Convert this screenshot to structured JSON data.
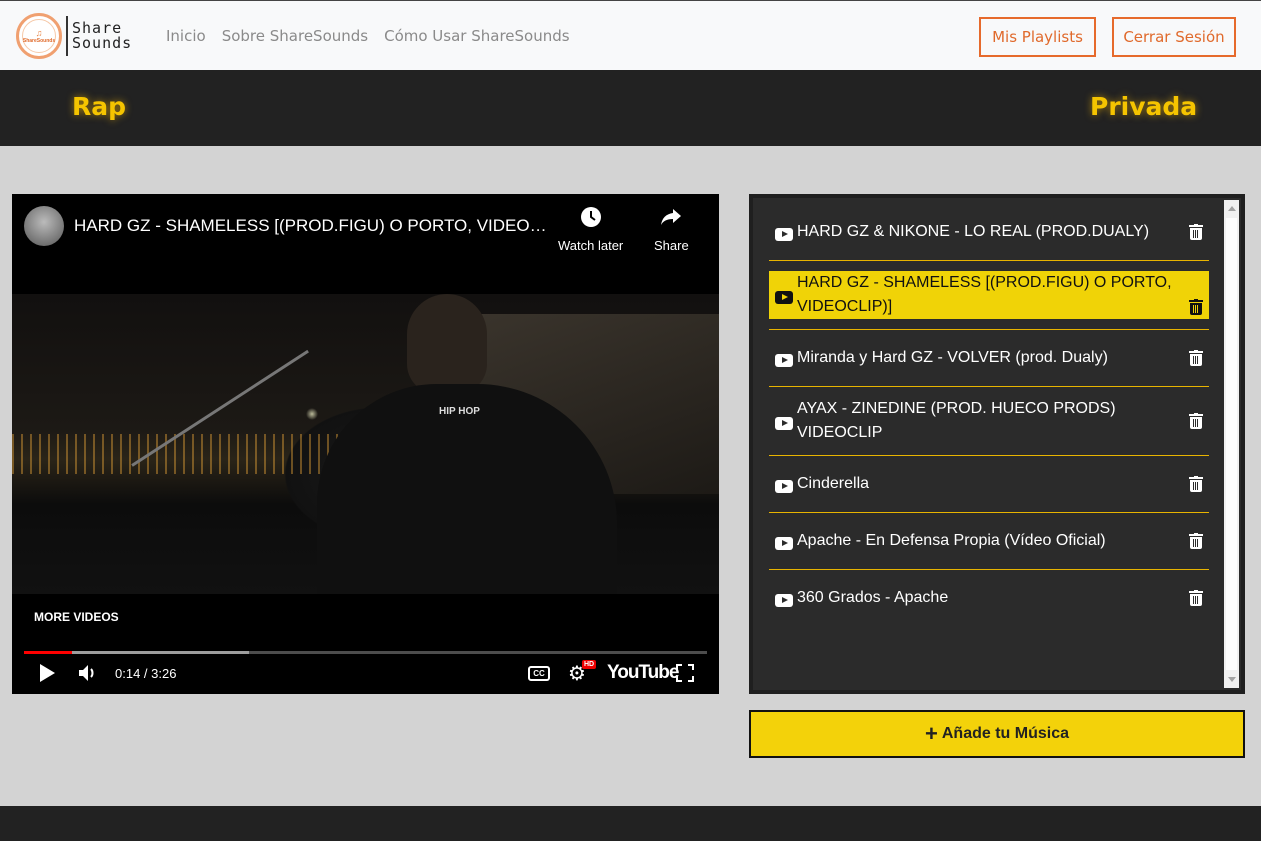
{
  "navbar": {
    "logo_top": "Share",
    "logo_bottom": "Sounds",
    "logo_small": "ShareSounds",
    "links": [
      "Inicio",
      "Sobre ShareSounds",
      "Cómo Usar ShareSounds"
    ],
    "btn_playlists": "Mis Playlists",
    "btn_logout": "Cerrar Sesión",
    "accent_color": "#e66a2c"
  },
  "playlist": {
    "genre": "Rap",
    "visibility": "Privada",
    "accent_color": "#f5c400"
  },
  "player": {
    "title": "HARD GZ - SHAMELESS [(PROD.FIGU) O PORTO, VIDEOCLIP)]",
    "watch_later": "Watch later",
    "share": "Share",
    "more_videos": "MORE VIDEOS",
    "time": "0:14 / 3:26",
    "played_fraction": 0.07,
    "buffered_fraction": 0.33,
    "youtube_brand": "YouTube",
    "hd_badge": "HD",
    "cc_label": "CC",
    "shirt_text": "HIP HOP"
  },
  "songs": [
    {
      "title": "HARD GZ & NIKONE - LO REAL (PROD.DUALY)",
      "active": false
    },
    {
      "title": "HARD GZ - SHAMELESS [(PROD.FIGU) O PORTO, VIDEOCLIP)]",
      "active": true
    },
    {
      "title": "Miranda y Hard GZ - VOLVER (prod. Dualy)",
      "active": false
    },
    {
      "title": "AYAX - ZINEDINE (PROD. HUECO PRODS) VIDEOCLIP",
      "active": false
    },
    {
      "title": "Cinderella",
      "active": false
    },
    {
      "title": "Apache - En Defensa Propia (Vídeo Oficial)",
      "active": false
    },
    {
      "title": "360 Grados - Apache",
      "active": false
    }
  ],
  "add_music": {
    "plus": "+",
    "label": "Añade tu Música",
    "color": "#f3d20a"
  }
}
